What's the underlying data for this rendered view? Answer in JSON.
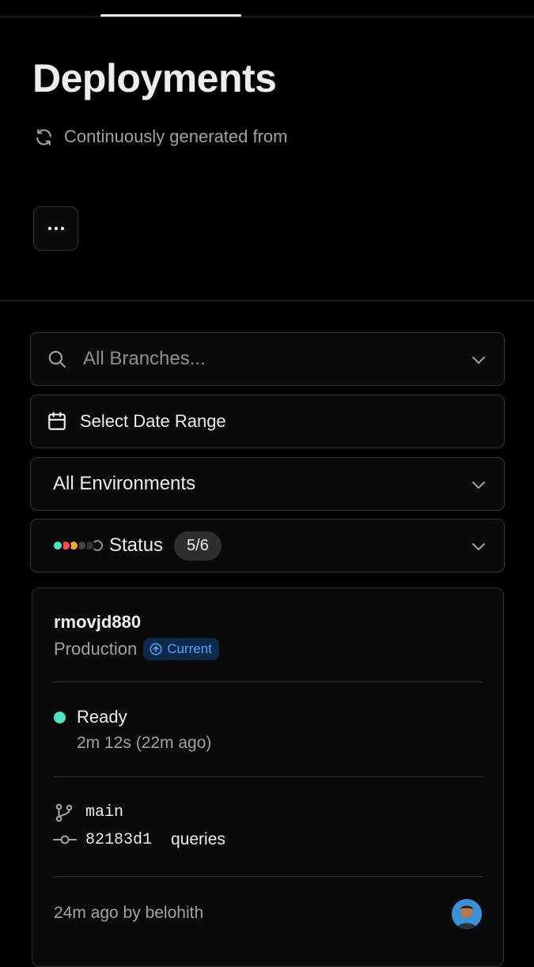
{
  "header": {
    "title": "Deployments",
    "subtitle": "Continuously generated from"
  },
  "filters": {
    "branch_placeholder": "All Branches...",
    "date_label": "Select Date Range",
    "environment_label": "All Environments",
    "status_label": "Status",
    "status_count": "5/6",
    "status_dot_colors": [
      "#50e3c2",
      "#ff4d4d",
      "#f5a623",
      "#444444",
      "#333333",
      "#111111"
    ]
  },
  "deployment": {
    "id": "rmovjd880",
    "environment": "Production",
    "current_label": "Current",
    "status": "Ready",
    "status_color": "#50e3c2",
    "duration": "2m 12s (22m ago)",
    "branch": "main",
    "commit_hash": "82183d1",
    "commit_message": "queries",
    "meta": "24m ago by belohith"
  },
  "icons": {
    "subtitle": "sync-icon",
    "more": "more-icon",
    "search": "search-icon",
    "calendar": "calendar-icon",
    "chevron": "chevron-down-icon",
    "current": "arrow-up-circle-icon",
    "branch": "git-branch-icon",
    "commit": "git-commit-icon"
  }
}
